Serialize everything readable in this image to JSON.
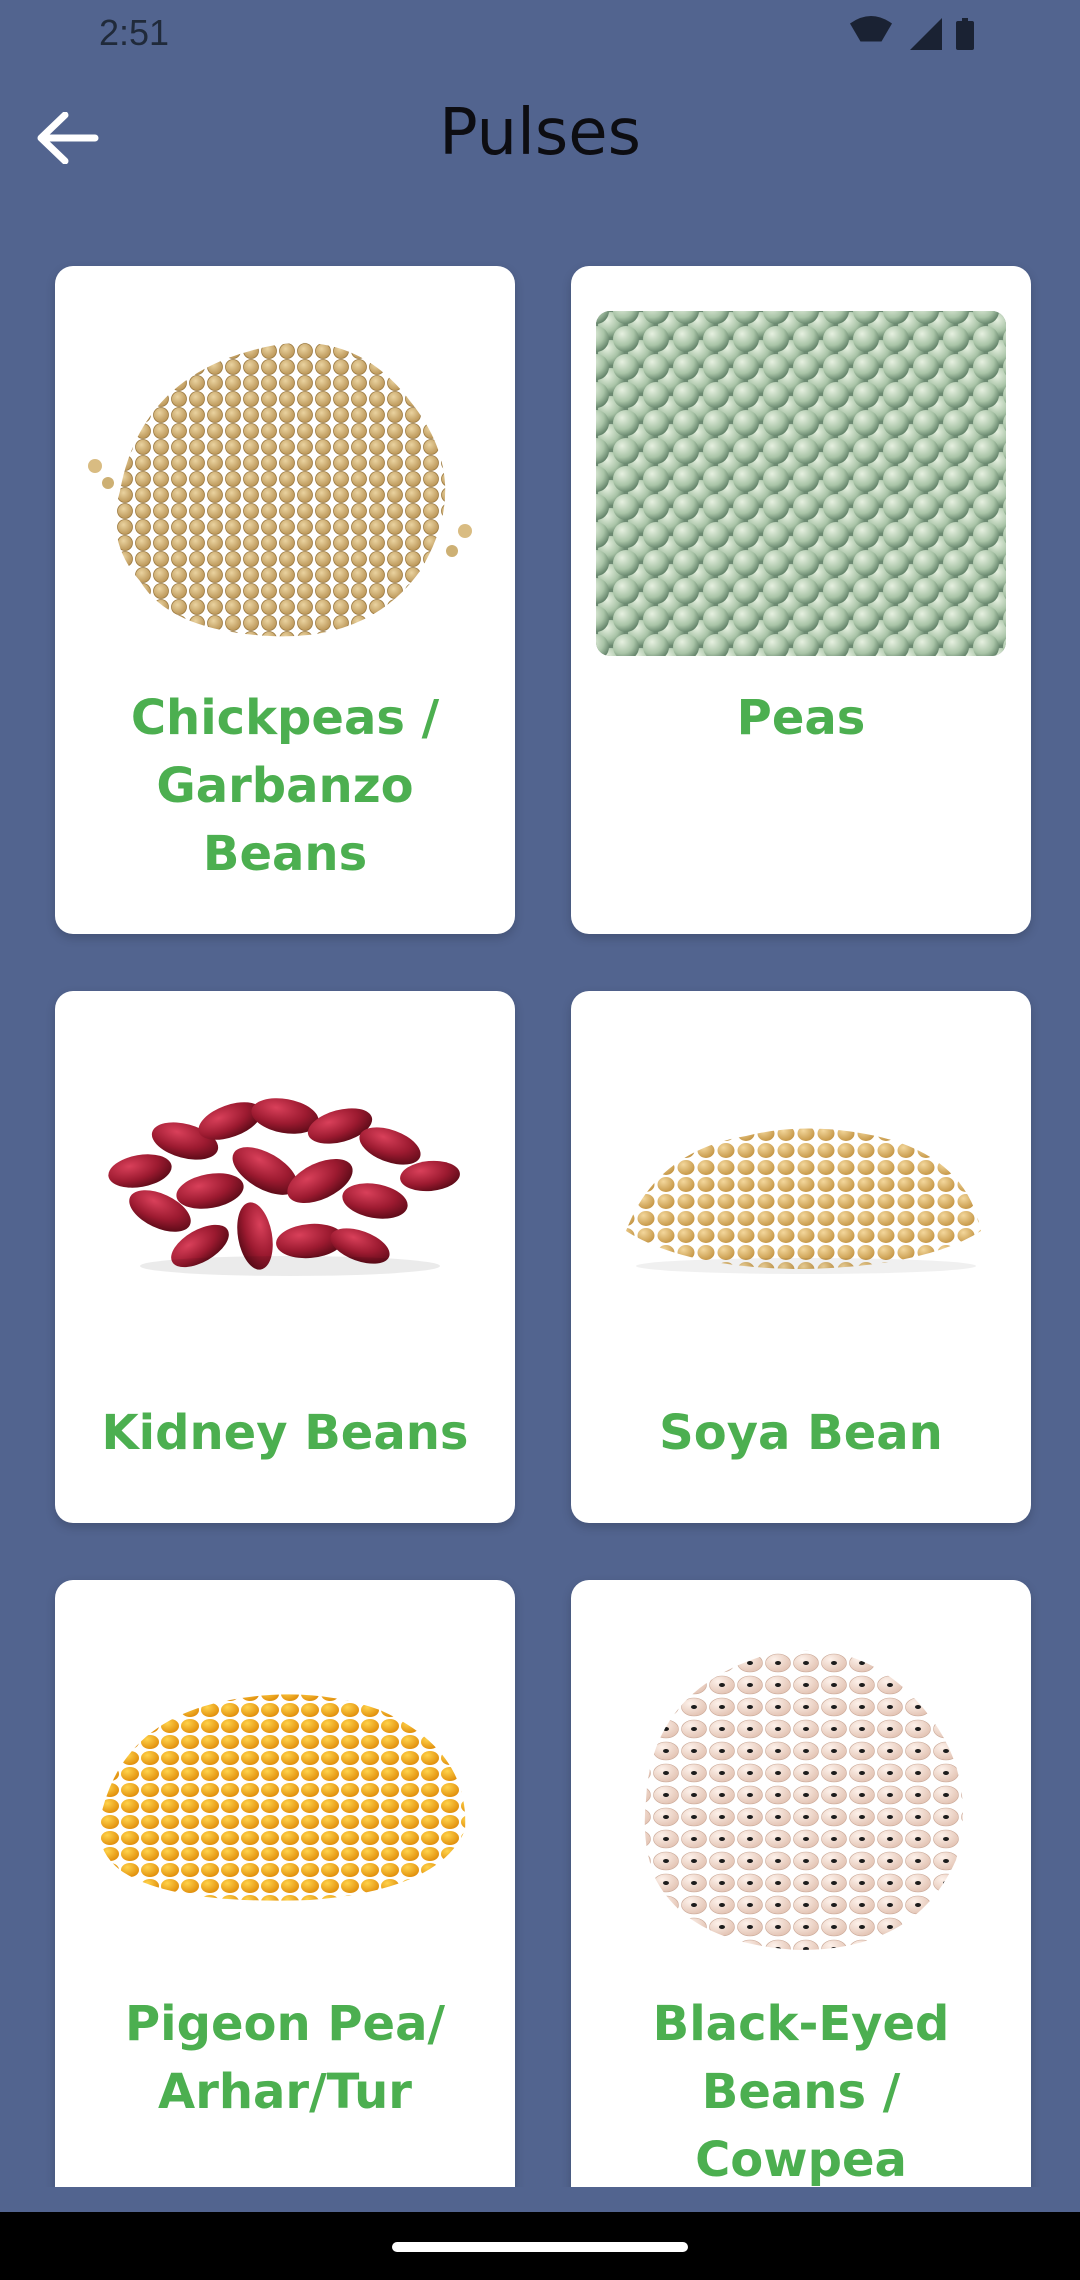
{
  "status_bar": {
    "time": "2:51",
    "icons": [
      "wifi-icon",
      "signal-icon",
      "battery-icon"
    ]
  },
  "app_bar": {
    "back_icon": "arrow-left-icon",
    "title": "Pulses"
  },
  "colors": {
    "background": "#52648f",
    "card": "#ffffff",
    "card_label": "#4caf50"
  },
  "cards": [
    {
      "name": "Chickpeas / Garbanzo Beans",
      "image": "chickpeas-image"
    },
    {
      "name": "Peas",
      "image": "peas-image"
    },
    {
      "name": "Kidney Beans",
      "image": "kidney-beans-image"
    },
    {
      "name": "Soya Bean",
      "image": "soya-bean-image"
    },
    {
      "name": "Pigeon Pea/ Arhar/Tur",
      "image": "pigeon-pea-image"
    },
    {
      "name": "Black-Eyed Beans / Cowpea",
      "image": "black-eyed-beans-image"
    }
  ]
}
